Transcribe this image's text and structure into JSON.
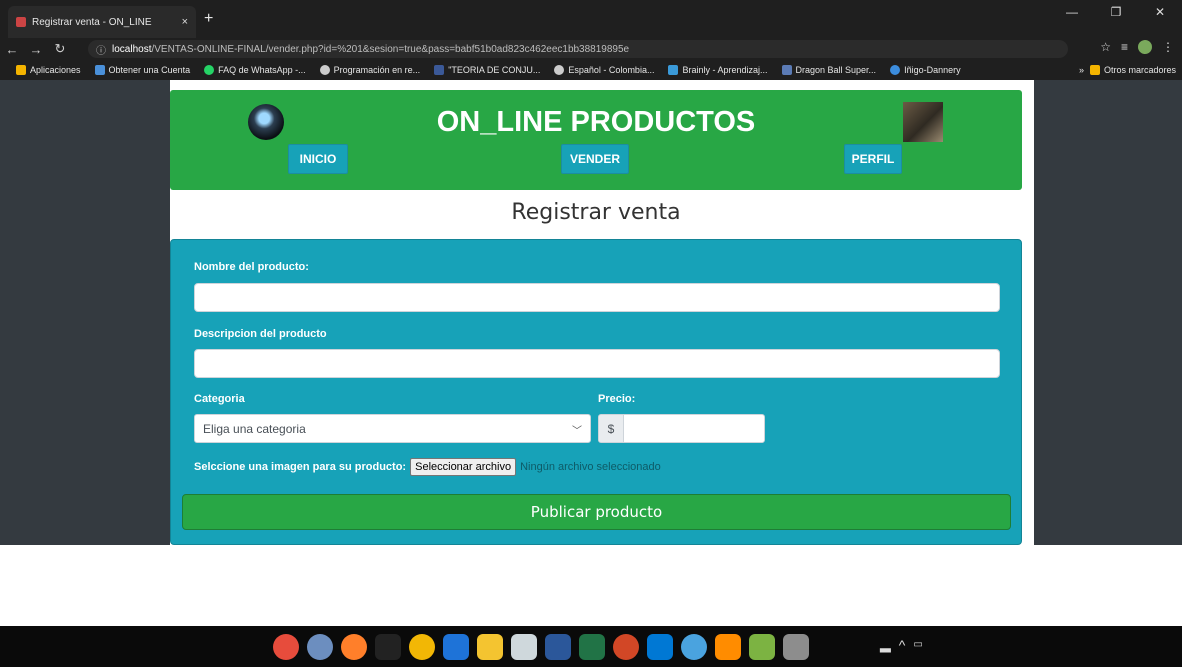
{
  "browser": {
    "tab_title": "Registrar venta - ON_LINE",
    "tab_close": "×",
    "new_tab": "+",
    "url_host": "localhost",
    "url_path": "/VENTAS-ONLINE-FINAL/vender.php?id=%201&sesion=true&pass=babf51b0ad823c462eec1bb38819895e",
    "bookmarks": [
      {
        "label": "Aplicaciones",
        "color": "#f4b400"
      },
      {
        "label": "Obtener una Cuenta",
        "color": "#4a90d9"
      },
      {
        "label": "FAQ de WhatsApp -...",
        "color": "#25d366"
      },
      {
        "label": "Programación en re...",
        "color": "#cccccc"
      },
      {
        "label": "\"TEORIA DE CONJU...",
        "color": "#3b5998"
      },
      {
        "label": "Español - Colombia...",
        "color": "#cccccc"
      },
      {
        "label": "Brainly - Aprendizaj...",
        "color": "#3a9ad9"
      },
      {
        "label": "Dragon Ball Super...",
        "color": "#5b7bb5"
      },
      {
        "label": "Iñigo-Dannery",
        "color": "#3c8dde"
      }
    ],
    "other_bookmarks": "Otros marcadores",
    "more": "»"
  },
  "header": {
    "site_title": "ON_LINE PRODUCTOS",
    "nav": {
      "inicio": "INICIO",
      "vender": "VENDER",
      "perfil": "PERFIL"
    }
  },
  "page": {
    "title": "Registrar venta"
  },
  "form": {
    "product_name_label": "Nombre del producto:",
    "product_name_value": "",
    "description_label": "Descripcion del producto",
    "description_value": "",
    "category_label": "Categoria",
    "category_selected": "Eliga una categoria",
    "price_label": "Precio:",
    "price_prefix": "$",
    "price_value": "",
    "image_label": "Selccione una imagen para su producto:",
    "file_button": "Seleccionar archivo",
    "file_status": "Ningún archivo seleccionado",
    "submit": "Publicar producto"
  },
  "colors": {
    "header_green": "#28a745",
    "form_teal": "#17a2b8",
    "sidebar_dark": "#343a40"
  }
}
